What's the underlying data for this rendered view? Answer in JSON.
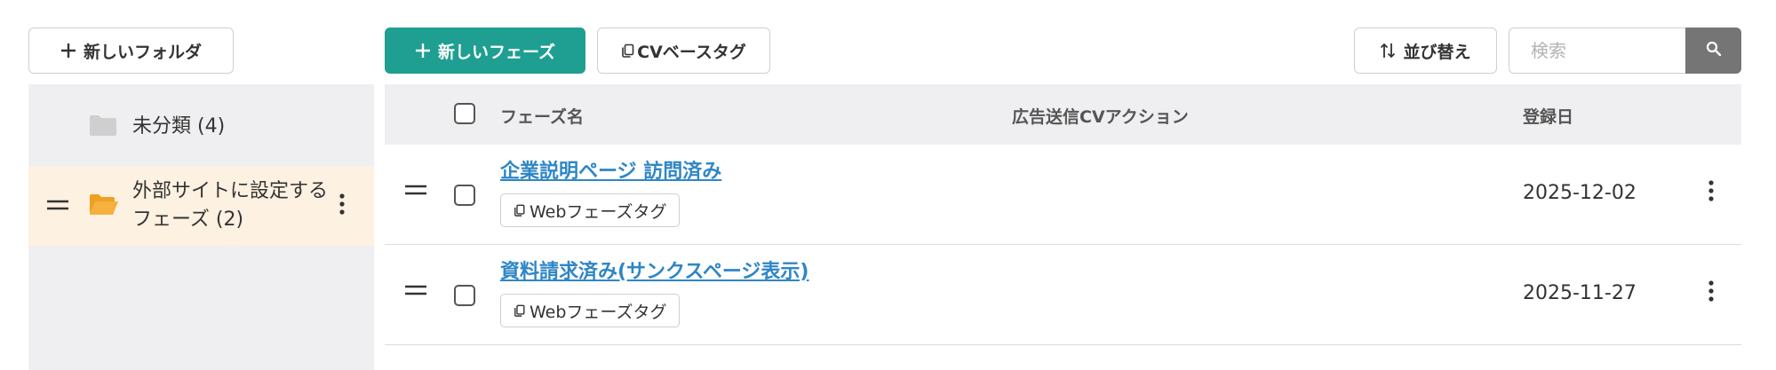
{
  "toolbar": {
    "new_folder_label": "新しいフォルダ",
    "new_phase_label": "新しいフェーズ",
    "cv_base_tag_label": "CVベースタグ",
    "sort_label": "並び替え",
    "search_placeholder": "検索",
    "search_value": ""
  },
  "sidebar": {
    "folders": [
      {
        "label": "未分類 (4)",
        "icon": "folder-icon",
        "selected": false
      },
      {
        "label": "外部サイトに設定するフェーズ (2)",
        "icon": "folder-open-icon",
        "selected": true
      }
    ]
  },
  "table": {
    "columns": {
      "name": "フェーズ名",
      "cv_action": "広告送信CVアクション",
      "registered": "登録日"
    },
    "rows": [
      {
        "name": "企業説明ページ 訪問済み",
        "tag": "Webフェーズタグ",
        "cv_action": "",
        "date": "2025-12-02"
      },
      {
        "name": "資料請求済み(サンクスページ表示)",
        "tag": "Webフェーズタグ",
        "cv_action": "",
        "date": "2025-11-27"
      }
    ]
  },
  "colors": {
    "primary": "#1f9f91",
    "link": "#2f86c6",
    "folder_accent": "#f0a020",
    "selected_folder_bg": "#fdf1e1",
    "sidebar_bg": "#efeff1"
  }
}
